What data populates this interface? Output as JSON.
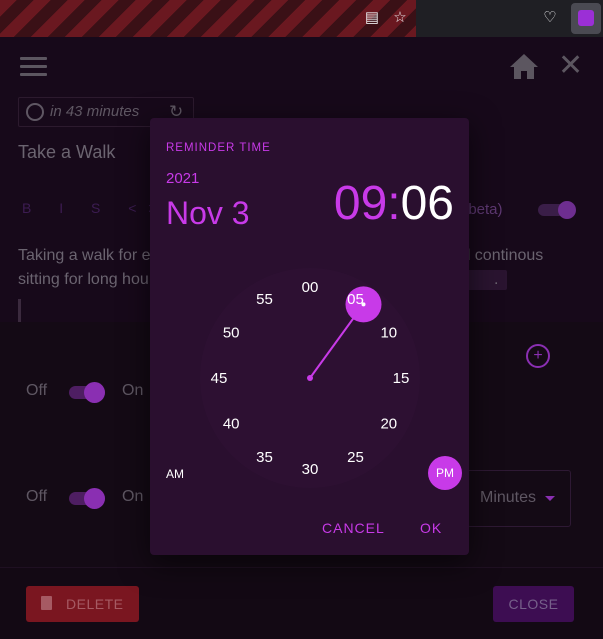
{
  "browser": {
    "icons": [
      "reader-view-icon",
      "bookmark-star-icon",
      "pocket-icon",
      "extension-icon"
    ]
  },
  "app": {
    "reminder_chip": "in 43 minutes",
    "task_title": "Take a Walk",
    "format_toolbar": "B I S <> ▭",
    "editor_label": "t (beta)",
    "description_line1": "Taking a walk for e",
    "description_line1_end": "oid continous",
    "description_line2": "sitting for long hou",
    "description_line2_end": "."
  },
  "settings": {
    "row1": {
      "off": "Off",
      "on": "On"
    },
    "row2": {
      "off": "Off",
      "on": "On"
    },
    "minutes_select": "Minutes"
  },
  "footer": {
    "delete_label": "DELETE",
    "close_label": "CLOSE"
  },
  "dialog": {
    "label": "REMINDER TIME",
    "year": "2021",
    "date": "Nov 3",
    "hour": "09",
    "separator": ":",
    "minute": "06",
    "am": "AM",
    "pm": "PM",
    "cancel": "CANCEL",
    "ok": "OK",
    "clock_numbers": [
      "00",
      "05",
      "10",
      "15",
      "20",
      "25",
      "30",
      "35",
      "40",
      "45",
      "50",
      "55"
    ],
    "selected_minute": 6
  },
  "colors": {
    "accent": "#c83ae8",
    "dialog_bg": "#2a0f2f",
    "delete_bg": "#7a1620",
    "close_bg": "#3d0d52"
  }
}
